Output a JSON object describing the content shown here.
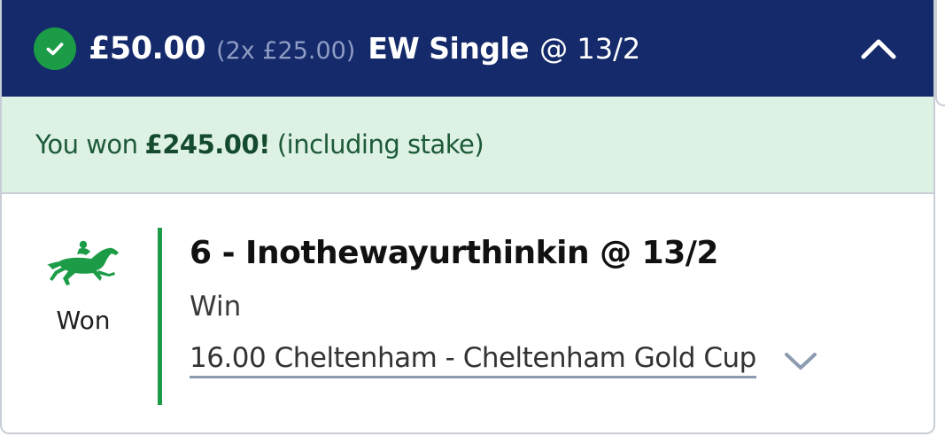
{
  "header": {
    "stake": "£50.00",
    "split": "(2x £25.00)",
    "bet_type": "EW Single",
    "odds": "@ 13/2",
    "status_icon": "check-circle-icon",
    "collapse_icon": "chevron-up-icon"
  },
  "result_banner": {
    "prefix": "You won",
    "amount": "£245.00!",
    "suffix": "(including stake)"
  },
  "selection": {
    "status_icon": "horse-racing-icon",
    "status_label": "Won",
    "runner": "6 - Inothewayurthinkin @ 13/2",
    "market": "Win",
    "event": "16.00 Cheltenham - Cheltenham Gold Cup",
    "expand_icon": "chevron-down-icon"
  },
  "colors": {
    "header_bg": "#152a6b",
    "success_green": "#1c9c46",
    "banner_bg": "#def1e5",
    "banner_text": "#1d5a38"
  }
}
